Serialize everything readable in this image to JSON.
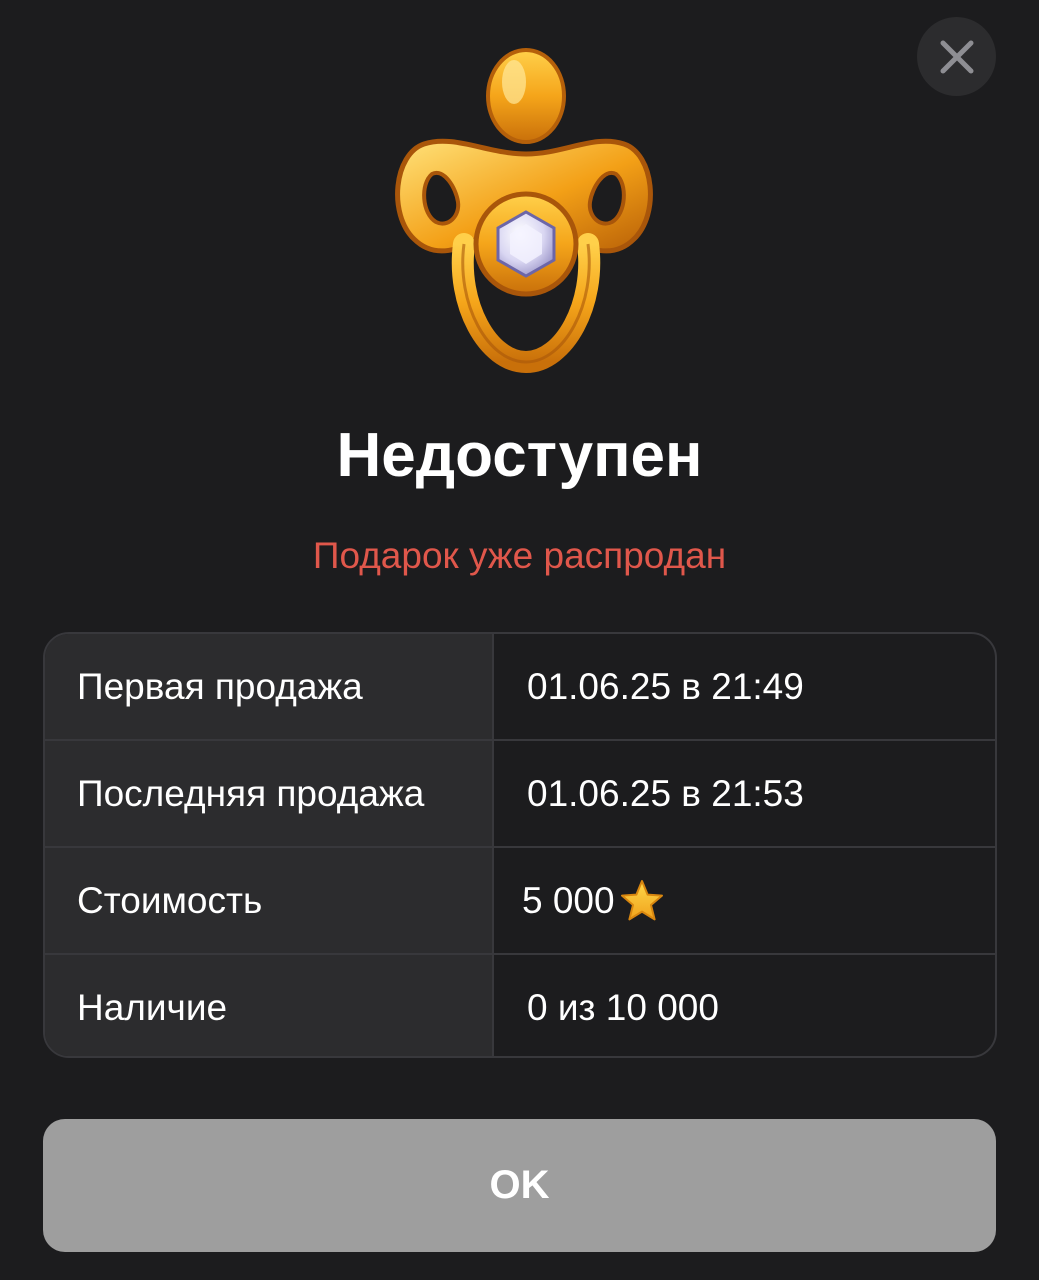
{
  "header": {
    "close_icon": "close-icon"
  },
  "gift": {
    "image_icon": "golden-pacifier-icon",
    "title": "Недоступен",
    "status": "Подарок уже распродан",
    "status_color": "#e0574b"
  },
  "details": {
    "rows": [
      {
        "label": "Первая продажа",
        "value": "01.06.25 в 21:49"
      },
      {
        "label": "Последняя продажа",
        "value": "01.06.25 в 21:53"
      },
      {
        "label": "Стоимость",
        "value": "5 000",
        "icon": "star-icon"
      },
      {
        "label": "Наличие",
        "value": "0 из 10 000"
      }
    ]
  },
  "actions": {
    "ok_label": "OK"
  }
}
